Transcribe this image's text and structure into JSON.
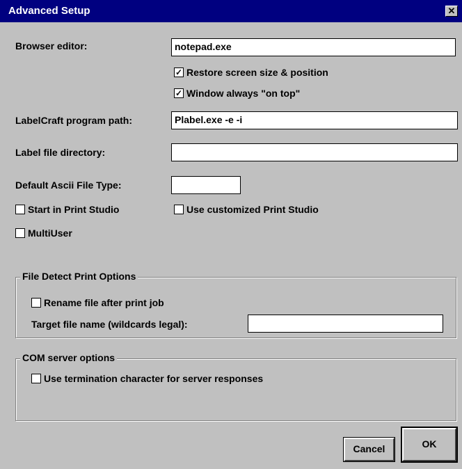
{
  "window": {
    "title": "Advanced Setup",
    "close_glyph": "✕"
  },
  "fields": {
    "browser_editor": {
      "label": "Browser editor:",
      "value": "notepad.exe"
    },
    "labelcraft_path": {
      "label": "LabelCraft program path:",
      "value": "Plabel.exe -e -i"
    },
    "label_file_dir": {
      "label": "Label file directory:",
      "value": ""
    },
    "ascii_file_type": {
      "label": "Default Ascii File Type:",
      "value": ""
    }
  },
  "checkboxes": {
    "restore_screen": {
      "label": "Restore screen size & position",
      "checked": true
    },
    "always_on_top": {
      "label": "Window always \"on top\"",
      "checked": true
    },
    "start_print_studio": {
      "label": "Start in Print Studio",
      "checked": false
    },
    "use_custom_print_studio": {
      "label": "Use customized Print Studio",
      "checked": false
    },
    "multiuser": {
      "label": "MultiUser",
      "checked": false
    }
  },
  "file_detect": {
    "legend": "File Detect Print Options",
    "rename_after_print": {
      "label": "Rename file after print job",
      "checked": false
    },
    "target_file": {
      "label": "Target file name (wildcards legal):",
      "value": ""
    }
  },
  "com_server": {
    "legend": "COM server options",
    "use_termination": {
      "label": "Use termination character for server responses",
      "checked": false
    }
  },
  "buttons": {
    "cancel": "Cancel",
    "ok": "OK"
  },
  "check_glyph": "✓"
}
